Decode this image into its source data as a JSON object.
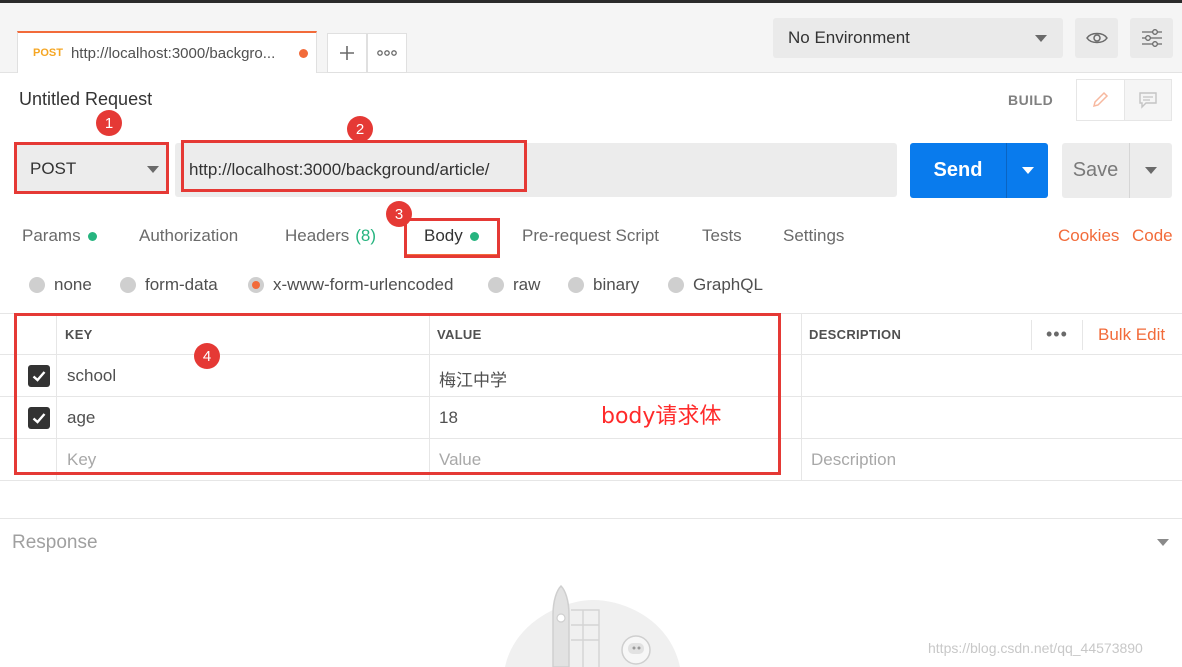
{
  "tab": {
    "method": "POST",
    "url": "http://localhost:3000/backgro..."
  },
  "environment": {
    "selected": "No Environment"
  },
  "request": {
    "title": "Untitled Request",
    "build_label": "BUILD",
    "method": "POST",
    "url": "http://localhost:3000/background/article/",
    "send_label": "Send",
    "save_label": "Save"
  },
  "subtabs": {
    "params": "Params",
    "authorization": "Authorization",
    "headers": "Headers",
    "headers_count": "(8)",
    "body": "Body",
    "prerequest": "Pre-request Script",
    "tests": "Tests",
    "settings": "Settings",
    "cookies": "Cookies",
    "code": "Code"
  },
  "body_types": [
    "none",
    "form-data",
    "x-www-form-urlencoded",
    "raw",
    "binary",
    "GraphQL"
  ],
  "body_type_selected": "x-www-form-urlencoded",
  "table": {
    "headers": {
      "key": "KEY",
      "value": "VALUE",
      "description": "DESCRIPTION",
      "bulk_edit": "Bulk Edit",
      "more": "•••"
    },
    "rows": [
      {
        "key": "school",
        "value": "梅江中学",
        "checked": true
      },
      {
        "key": "age",
        "value": "18",
        "checked": true
      }
    ],
    "placeholders": {
      "key": "Key",
      "value": "Value",
      "description": "Description"
    }
  },
  "response": {
    "label": "Response"
  },
  "annotations": {
    "badges": [
      "1",
      "2",
      "3",
      "4"
    ],
    "note": "body请求体",
    "color": "#e53935"
  },
  "watermark": "https://blog.csdn.net/qq_44573890",
  "colors": {
    "accent": "#f26b3a",
    "send": "#097bed",
    "status_dot": "#26b47f"
  }
}
